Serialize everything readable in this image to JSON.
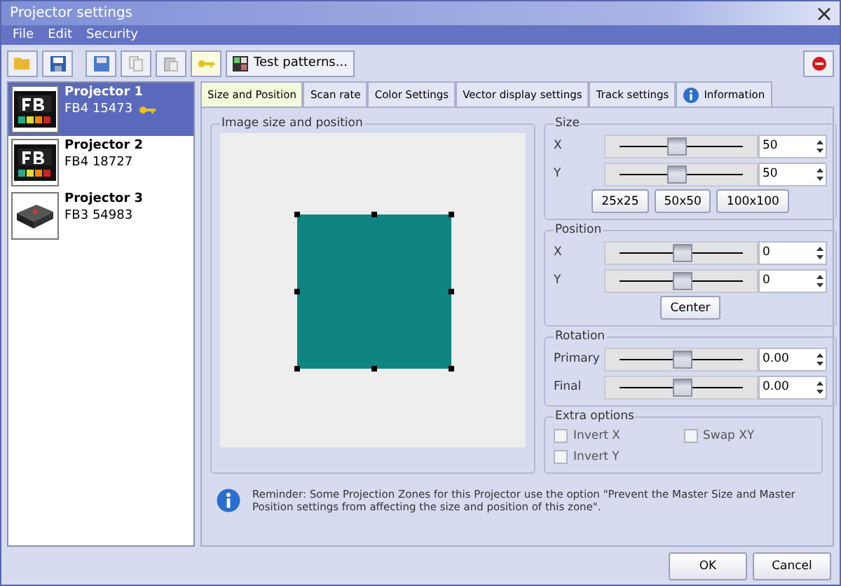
{
  "window": {
    "title": "Projector settings"
  },
  "menu": [
    "File",
    "Edit",
    "Security"
  ],
  "toolbar": {
    "test_patterns": "Test patterns..."
  },
  "projectors": [
    {
      "name": "Projector 1",
      "serial": "FB4 15473",
      "kind": "fb4",
      "key": true,
      "selected": true
    },
    {
      "name": "Projector 2",
      "serial": "FB4 18727",
      "kind": "fb4",
      "key": false,
      "selected": false
    },
    {
      "name": "Projector 3",
      "serial": "FB3 54983",
      "kind": "fb3",
      "key": false,
      "selected": false
    }
  ],
  "tabs": [
    {
      "label": "Size and Position",
      "selected": true
    },
    {
      "label": "Scan rate",
      "selected": false
    },
    {
      "label": "Color Settings",
      "selected": false
    },
    {
      "label": "Vector display settings",
      "selected": false
    },
    {
      "label": "Track settings",
      "selected": false
    },
    {
      "label": "Information",
      "selected": false,
      "kind": "info"
    }
  ],
  "preview": {
    "title": "Image size and position"
  },
  "size": {
    "title": "Size",
    "rows": [
      {
        "label": "X",
        "level": 0.45,
        "value": "50"
      },
      {
        "label": "Y",
        "level": 0.45,
        "value": "50"
      }
    ],
    "presets": [
      "25x25",
      "50x50",
      "100x100"
    ]
  },
  "position": {
    "title": "Position",
    "rows": [
      {
        "label": "X",
        "level": 0.5,
        "value": "0"
      },
      {
        "label": "Y",
        "level": 0.5,
        "value": "0"
      }
    ],
    "button": "Center"
  },
  "rotation": {
    "title": "Rotation",
    "rows": [
      {
        "label": "Primary",
        "level": 0.5,
        "value": "0.00"
      },
      {
        "label": "Final",
        "level": 0.5,
        "value": "0.00"
      }
    ]
  },
  "extra": {
    "title": "Extra options",
    "options": [
      {
        "label": "Invert X",
        "checked": false
      },
      {
        "label": "Swap XY",
        "checked": false
      },
      {
        "label": "Invert Y",
        "checked": false
      }
    ]
  },
  "note": "Reminder: Some Projection Zones for this Projector use the option \"Prevent the Master Size and Master Position settings from affecting the size and position of this zone\".",
  "buttons": [
    "OK",
    "Cancel"
  ]
}
